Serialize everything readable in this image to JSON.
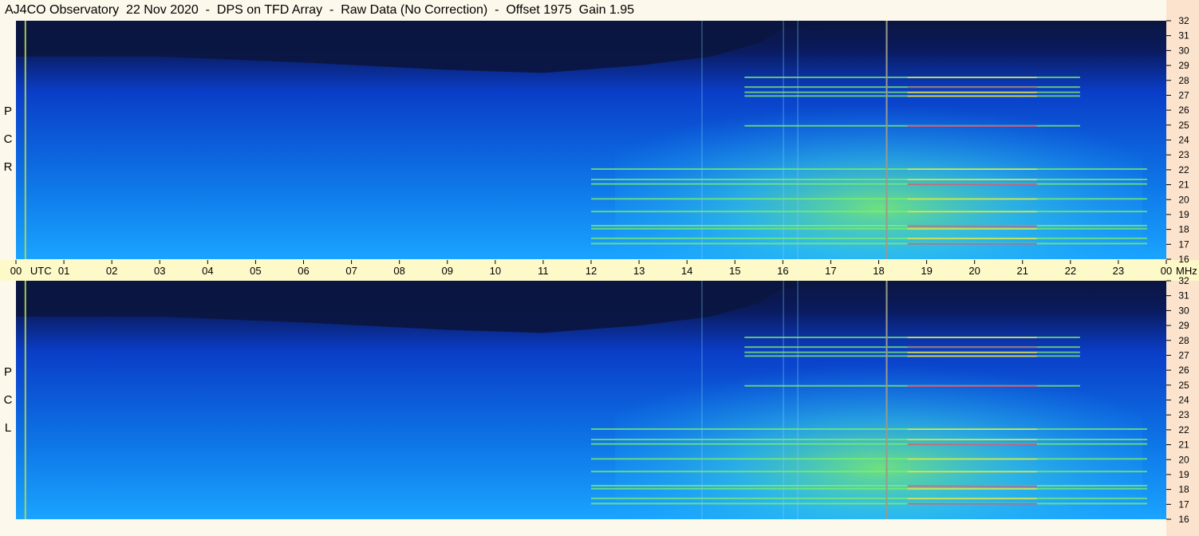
{
  "title": "AJ4CO Observatory  22 Nov 2020  -  DPS on TFD Array  -  Raw Data (No Correction)  -  Offset 1975  Gain 1.95",
  "panels": [
    {
      "label_chars": [
        "P",
        "C",
        "R"
      ]
    },
    {
      "label_chars": [
        "P",
        "C",
        "L"
      ]
    }
  ],
  "axis": {
    "utc_label": "UTC",
    "mhz_label": "MHz"
  },
  "chart_data": [
    {
      "type": "heatmap",
      "title": "AJ4CO Observatory  22 Nov 2020  -  DPS on TFD Array  -  Raw Data (No Correction)  -  Offset 1975  Gain 1.95",
      "panel": "RCP",
      "x_axis": {
        "unit": "UTC",
        "ticks": [
          "00",
          "01",
          "02",
          "03",
          "04",
          "05",
          "06",
          "07",
          "08",
          "09",
          "10",
          "11",
          "12",
          "13",
          "14",
          "15",
          "16",
          "17",
          "18",
          "19",
          "20",
          "21",
          "22",
          "23",
          "00"
        ],
        "range": [
          0,
          24
        ]
      },
      "y_axis": {
        "unit": "MHz",
        "ticks": [
          16,
          17,
          18,
          19,
          20,
          21,
          22,
          23,
          24,
          25,
          26,
          27,
          28,
          29,
          30,
          31,
          32
        ],
        "range": [
          16,
          32
        ]
      },
      "colors": {
        "background": "#0b1640",
        "low": "#0a3ec8",
        "mid": "#1aa4ff",
        "high": "#7ff06a",
        "peak": "#ff3070"
      },
      "vertical_marker_utc": 18.15,
      "bands_mhz": [
        17.05,
        17.4,
        18.05,
        18.25,
        19.2,
        20.05,
        21.05,
        21.35,
        22.05,
        24.95,
        26.95,
        27.2,
        27.55,
        28.2
      ]
    },
    {
      "type": "heatmap",
      "panel": "LCP",
      "x_axis": {
        "unit": "UTC",
        "ticks": [
          "00",
          "01",
          "02",
          "03",
          "04",
          "05",
          "06",
          "07",
          "08",
          "09",
          "10",
          "11",
          "12",
          "13",
          "14",
          "15",
          "16",
          "17",
          "18",
          "19",
          "20",
          "21",
          "22",
          "23",
          "00"
        ],
        "range": [
          0,
          24
        ]
      },
      "y_axis": {
        "unit": "MHz",
        "ticks": [
          16,
          17,
          18,
          19,
          20,
          21,
          22,
          23,
          24,
          25,
          26,
          27,
          28,
          29,
          30,
          31,
          32
        ],
        "range": [
          16,
          32
        ]
      },
      "colors": {
        "background": "#0b1640",
        "low": "#0a3ec8",
        "mid": "#1aa4ff",
        "high": "#7ff06a",
        "peak": "#ff3070"
      },
      "vertical_marker_utc": 18.15,
      "bands_mhz": [
        17.05,
        17.4,
        18.05,
        18.25,
        19.2,
        20.05,
        21.05,
        21.35,
        22.05,
        24.95,
        26.95,
        27.2,
        27.55,
        28.2
      ]
    }
  ]
}
